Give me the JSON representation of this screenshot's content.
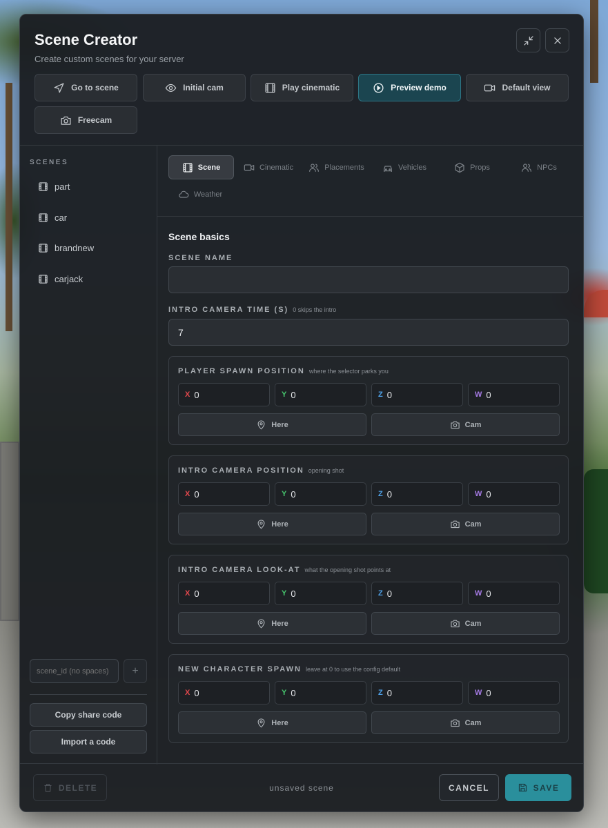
{
  "window": {
    "title": "Scene Creator",
    "subtitle": "Create custom scenes for your server"
  },
  "header_actions": [
    {
      "label": "Go to scene",
      "icon": "navigation-arrow-icon"
    },
    {
      "label": "Initial cam",
      "icon": "eye-icon"
    },
    {
      "label": "Play cinematic",
      "icon": "film-icon"
    },
    {
      "label": "Preview demo",
      "icon": "play-circle-icon",
      "active": true
    },
    {
      "label": "Default view",
      "icon": "video-camera-icon"
    },
    {
      "label": "Freecam",
      "icon": "camera-icon"
    }
  ],
  "sidebar": {
    "heading": "SCENES",
    "scenes": [
      "part",
      "car",
      "brandnew",
      "carjack"
    ],
    "new_scene_placeholder": "scene_id (no spaces)",
    "add_label": "+",
    "copy_share_label": "Copy share code",
    "import_label": "Import a code"
  },
  "tabs": [
    {
      "label": "Scene",
      "icon": "film-icon",
      "active": true
    },
    {
      "label": "Cinematic",
      "icon": "video-camera-icon"
    },
    {
      "label": "Placements",
      "icon": "users-icon"
    },
    {
      "label": "Vehicles",
      "icon": "car-icon"
    },
    {
      "label": "Props",
      "icon": "box-icon"
    },
    {
      "label": "NPCs",
      "icon": "users-icon"
    },
    {
      "label": "Weather",
      "icon": "cloud-icon"
    }
  ],
  "form": {
    "section_title": "Scene basics",
    "scene_name": {
      "label": "SCENE NAME",
      "value": ""
    },
    "intro_time": {
      "label": "INTRO CAMERA TIME (S)",
      "hint": "0 skips the intro",
      "value": "7"
    },
    "groups": [
      {
        "label": "PLAYER SPAWN POSITION",
        "hint": "where the selector parks you",
        "x": "0",
        "y": "0",
        "z": "0",
        "w": "0"
      },
      {
        "label": "INTRO CAMERA POSITION",
        "hint": "opening shot",
        "x": "0",
        "y": "0",
        "z": "0",
        "w": "0"
      },
      {
        "label": "INTRO CAMERA LOOK-AT",
        "hint": "what the opening shot points at",
        "x": "0",
        "y": "0",
        "z": "0",
        "w": "0"
      },
      {
        "label": "NEW CHARACTER SPAWN",
        "hint": "leave at 0 to use the config default",
        "x": "0",
        "y": "0",
        "z": "0",
        "w": "0"
      }
    ],
    "axis_labels": {
      "x": "X",
      "y": "Y",
      "z": "Z",
      "w": "W"
    },
    "axis_colors": {
      "x": "#e5484d",
      "y": "#46c46d",
      "z": "#4ea1e8",
      "w": "#a67be6"
    },
    "here_label": "Here",
    "cam_label": "Cam"
  },
  "footer": {
    "delete_label": "DELETE",
    "status": "unsaved scene",
    "cancel_label": "CANCEL",
    "save_label": "SAVE"
  },
  "colors": {
    "accent": "#2aa7ba",
    "panel": "#1b1e22"
  }
}
